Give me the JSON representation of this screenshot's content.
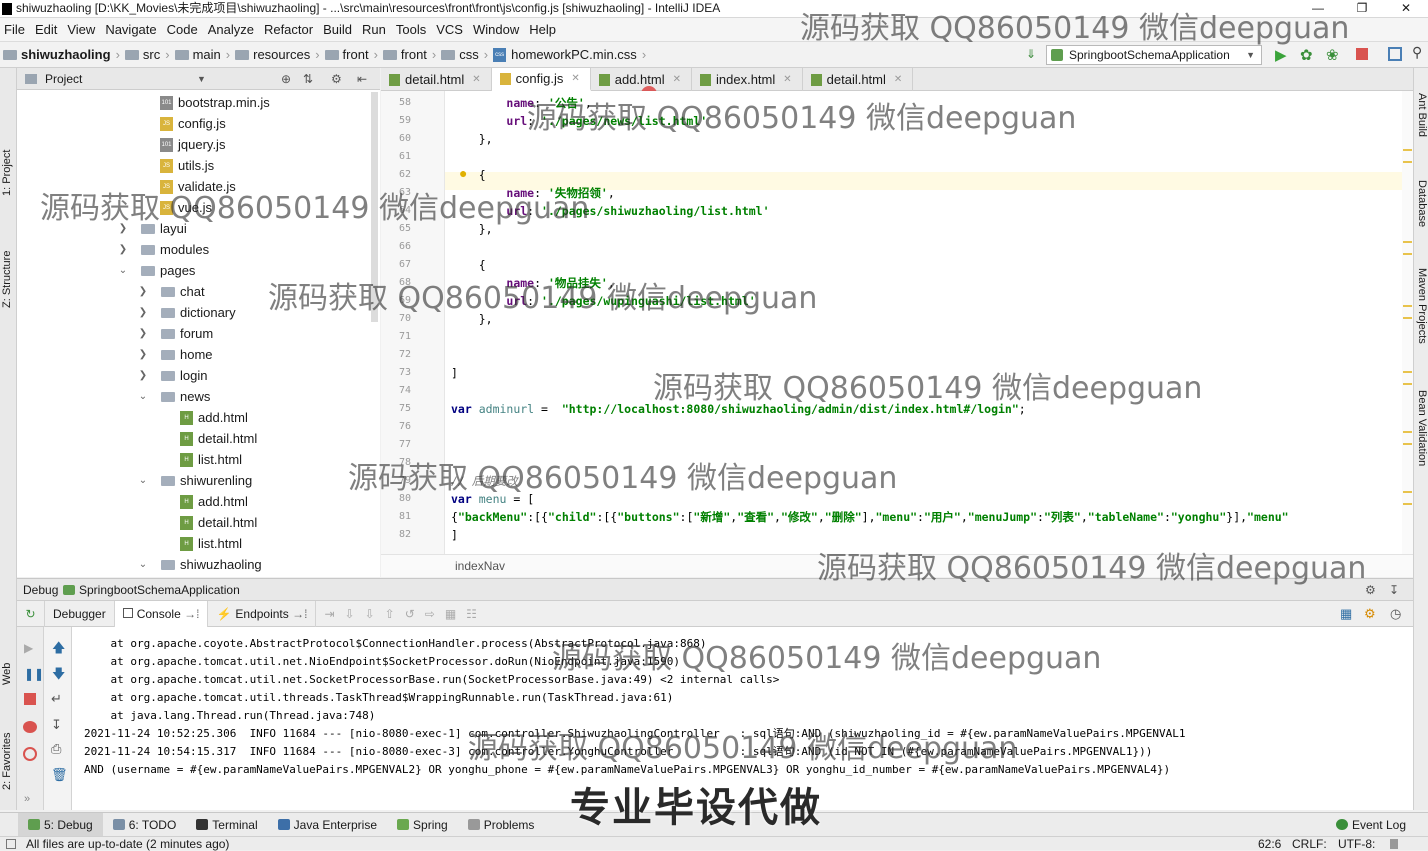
{
  "window": {
    "title": "shiwuzhaoling [D:\\KK_Movies\\未完成项目\\shiwuzhaoling] - ...\\src\\main\\resources\\front\\front\\js\\config.js [shiwuzhaoling] - IntelliJ IDEA"
  },
  "menu": [
    "File",
    "Edit",
    "View",
    "Navigate",
    "Code",
    "Analyze",
    "Refactor",
    "Build",
    "Run",
    "Tools",
    "VCS",
    "Window",
    "Help"
  ],
  "nav": {
    "crumbs": [
      "shiwuzhaoling",
      "src",
      "main",
      "resources",
      "front",
      "front",
      "css",
      "homeworkPC.min.css"
    ],
    "run_config": "SpringbootSchemaApplication"
  },
  "project": {
    "header": "Project",
    "tree": [
      {
        "label": "bootstrap.min.js",
        "type": "min"
      },
      {
        "label": "config.js",
        "type": "js"
      },
      {
        "label": "jquery.js",
        "type": "min"
      },
      {
        "label": "utils.js",
        "type": "js"
      },
      {
        "label": "validate.js",
        "type": "js"
      },
      {
        "label": "vue.js",
        "type": "js"
      },
      {
        "label": "layui",
        "type": "folder"
      },
      {
        "label": "modules",
        "type": "folder"
      },
      {
        "label": "pages",
        "type": "folder-open"
      },
      {
        "label": "chat",
        "type": "folder"
      },
      {
        "label": "dictionary",
        "type": "folder"
      },
      {
        "label": "forum",
        "type": "folder"
      },
      {
        "label": "home",
        "type": "folder"
      },
      {
        "label": "login",
        "type": "folder"
      },
      {
        "label": "news",
        "type": "folder-open"
      },
      {
        "label": "add.html",
        "type": "html"
      },
      {
        "label": "detail.html",
        "type": "html"
      },
      {
        "label": "list.html",
        "type": "html"
      },
      {
        "label": "shiwurenling",
        "type": "folder-open"
      },
      {
        "label": "add.html",
        "type": "html"
      },
      {
        "label": "detail.html",
        "type": "html"
      },
      {
        "label": "list.html",
        "type": "html"
      },
      {
        "label": "shiwuzhaoling",
        "type": "folder-open"
      }
    ]
  },
  "editor_tabs": [
    "detail.html",
    "config.js",
    "add.html",
    "index.html",
    "detail.html"
  ],
  "editor": {
    "lines": [
      {
        "n": "58",
        "t": "        name: '公告',"
      },
      {
        "n": "59",
        "t": "        url: './pages/news/list.html'"
      },
      {
        "n": "60",
        "t": "    },"
      },
      {
        "n": "61",
        "t": ""
      },
      {
        "n": "62",
        "t": "    {"
      },
      {
        "n": "63",
        "t": "        name: '失物招领',"
      },
      {
        "n": "64",
        "t": "        url: './pages/shiwuzhaoling/list.html'"
      },
      {
        "n": "65",
        "t": "    },"
      },
      {
        "n": "66",
        "t": ""
      },
      {
        "n": "67",
        "t": "    {"
      },
      {
        "n": "68",
        "t": "        name: '物品挂失',"
      },
      {
        "n": "69",
        "t": "        url: './pages/wupinguashi/list.html'"
      },
      {
        "n": "70",
        "t": "    },"
      },
      {
        "n": "71",
        "t": ""
      },
      {
        "n": "72",
        "t": ""
      },
      {
        "n": "73",
        "t": "]"
      },
      {
        "n": "74",
        "t": ""
      },
      {
        "n": "75",
        "t": "var adminurl =  \"http://localhost:8080/shiwuzhaoling/admin/dist/index.html#/login\";"
      },
      {
        "n": "76",
        "t": ""
      },
      {
        "n": "77",
        "t": ""
      },
      {
        "n": "78",
        "t": ""
      },
      {
        "n": "79",
        "t": "// 后期要改"
      },
      {
        "n": "80",
        "t": "var menu = ["
      },
      {
        "n": "81",
        "t": "{\"backMenu\":[{\"child\":[{\"buttons\":[\"新增\",\"查看\",\"修改\",\"删除\"],\"menu\":\"用户\",\"menuJump\":\"列表\",\"tableName\":\"yonghu\"}],\"menu\""
      },
      {
        "n": "82",
        "t": "]"
      }
    ],
    "breadcrumb": "indexNav"
  },
  "debug": {
    "header": "Debug",
    "config": "SpringbootSchemaApplication",
    "tabs": [
      "Debugger",
      "Console",
      "Endpoints"
    ],
    "console": [
      "    at org.apache.coyote.AbstractProtocol$ConnectionHandler.process(AbstractProtocol.java:868)",
      "    at org.apache.tomcat.util.net.NioEndpoint$SocketProcessor.doRun(NioEndpoint.java:1590)",
      "    at org.apache.tomcat.util.net.SocketProcessorBase.run(SocketProcessorBase.java:49) <2 internal calls>",
      "    at org.apache.tomcat.util.threads.TaskThread$WrappingRunnable.run(TaskThread.java:61)",
      "    at java.lang.Thread.run(Thread.java:748)",
      "2021-11-24 10:52:25.306  INFO 11684 --- [nio-8080-exec-1] com.controller.ShiwuzhaolingController   : sql语句:AND (shiwuzhaoling_id = #{ew.paramNameValuePairs.MPGENVAL1",
      "2021-11-24 10:54:15.317  INFO 11684 --- [nio-8080-exec-3] com.controller.YonghuController          : sql语句:AND (id NOT IN (#{ew.paramNameValuePairs.MPGENVAL1}))",
      "AND (username = #{ew.paramNameValuePairs.MPGENVAL2} OR yonghu_phone = #{ew.paramNameValuePairs.MPGENVAL3} OR yonghu_id_number = #{ew.paramNameValuePairs.MPGENVAL4})"
    ]
  },
  "bottom_tabs": [
    "5: Debug",
    "6: TODO",
    "Terminal",
    "Java Enterprise",
    "Spring",
    "Problems"
  ],
  "event_log": "Event Log",
  "status": {
    "message": "All files are up-to-date (2 minutes ago)",
    "position": "62:6",
    "line_sep": "CRLF:",
    "encoding": "UTF-8:"
  },
  "side_tools_left": [
    "1: Project",
    "Z: Structure",
    "Web",
    "2: Favorites"
  ],
  "side_tools_right": [
    "Ant Build",
    "Database",
    "Maven Projects",
    "Bean Validation"
  ],
  "watermark": "源码获取 QQ86050149 微信deepguan",
  "banner": "专业毕设代做"
}
